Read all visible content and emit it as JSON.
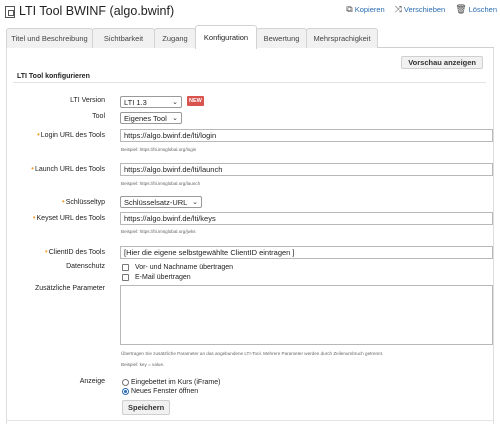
{
  "header": {
    "title": "LTI Tool BWINF (algo.bwinf)",
    "actions": [
      {
        "label": "Kopieren",
        "icon": "copy-icon"
      },
      {
        "label": "Verschieben",
        "icon": "move-icon"
      },
      {
        "label": "Löschen",
        "icon": "trash-icon"
      }
    ]
  },
  "tabs": [
    {
      "label": "Titel und Beschreibung",
      "active": false
    },
    {
      "label": "Sichtbarkeit",
      "active": false
    },
    {
      "label": "Zugang",
      "active": false
    },
    {
      "label": "Konfiguration",
      "active": true
    },
    {
      "label": "Bewertung",
      "active": false
    },
    {
      "label": "Mehrsprachigkeit",
      "active": false
    }
  ],
  "preview_button": "Vorschau anzeigen",
  "section_title": "LTI Tool konfigurieren",
  "form": {
    "lti_version": {
      "label": "LTI Version",
      "value": "LTI 1.3",
      "badge": "NEW"
    },
    "tool": {
      "label": "Tool",
      "value": "Eigenes Tool"
    },
    "login_url": {
      "label": "Login URL des Tools",
      "value": "https://algo.bwinf.de/lti/login",
      "hint": "Beispiel: https://lti.imsglobal.org/login"
    },
    "launch_url": {
      "label": "Launch URL des Tools",
      "value": "https://algo.bwinf.de/lti/launch",
      "hint": "Beispiel: https://lti.imsglobal.org/launch"
    },
    "key_type": {
      "label": "Schlüsseltyp",
      "value": "Schlüsselsatz-URL"
    },
    "keyset_url": {
      "label": "Keyset URL des Tools",
      "value": "https://algo.bwinf.de/lti/keys",
      "hint": "Beispiel: https://lti.imsglobal.org/jwks"
    },
    "client_id": {
      "label": "ClientID des Tools",
      "value": "[Hier die eigene selbstgewählte ClientID eintragen ]"
    },
    "privacy": {
      "label": "Datenschutz",
      "options": [
        "Vor- und Nachname übertragen",
        "E-Mail übertragen"
      ]
    },
    "extra_params": {
      "label": "Zusätzliche Parameter",
      "hint1": "Übertragen Sie zusätzliche Parameter an das angebundene LTI-Tool. Mehrere Parameter werden durch Zeilenumbruch getrennt.",
      "hint2": "Beispiel: key = value."
    },
    "display": {
      "label": "Anzeige",
      "options": [
        {
          "label": "Eingebettet im Kurs (iFrame)",
          "selected": false
        },
        {
          "label": "Neues Fenster öffnen",
          "selected": true
        }
      ]
    },
    "save_button": "Speichern"
  },
  "colors": {
    "link": "#2a6db0",
    "required": "#f0a030",
    "badge": "#d9534f"
  }
}
